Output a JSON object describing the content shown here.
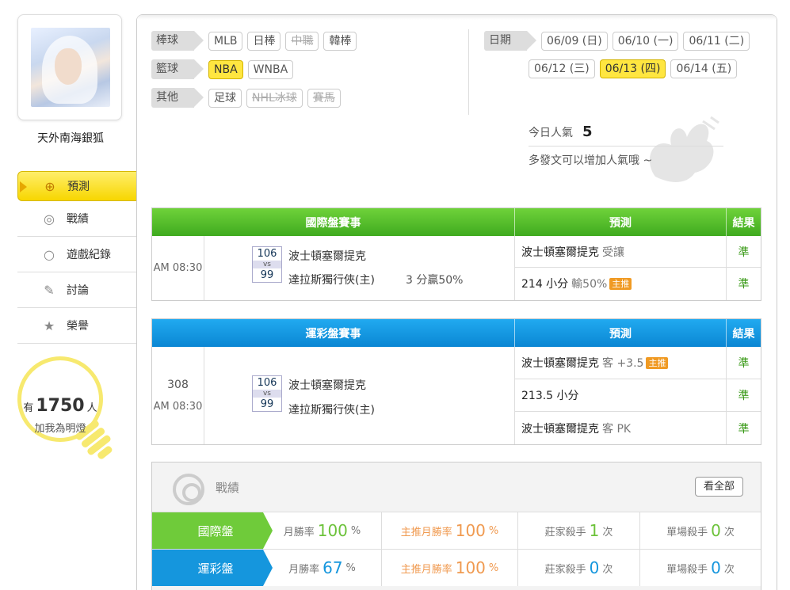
{
  "user": {
    "name": "天外南海銀狐"
  },
  "nav": [
    {
      "label": "預測",
      "icon": "target-icon",
      "active": true
    },
    {
      "label": "戰績",
      "icon": "chart-swirl-icon",
      "active": false
    },
    {
      "label": "遊戲紀錄",
      "icon": "ring-icon",
      "active": false
    },
    {
      "label": "討論",
      "icon": "discuss-icon",
      "active": false
    },
    {
      "label": "榮譽",
      "icon": "medal-icon",
      "active": false
    }
  ],
  "fans": {
    "prefix": "有",
    "count": "1750",
    "suffix": "人",
    "sub": "加我為明燈"
  },
  "filters": {
    "baseball": {
      "label": "棒球",
      "tags": [
        "MLB",
        "日棒",
        "中職",
        "韓棒"
      ]
    },
    "basketball": {
      "label": "籃球",
      "tags": [
        "NBA",
        "WNBA"
      ]
    },
    "other": {
      "label": "其他",
      "tags": [
        "足球",
        "NHL冰球",
        "賽馬"
      ]
    },
    "date": {
      "label": "日期",
      "tags": [
        "06/09 (日)",
        "06/10 (一)",
        "06/11 (二)",
        "06/12 (三)",
        "06/13 (四)",
        "06/14 (五)"
      ]
    }
  },
  "popularity": {
    "label": "今日人氣",
    "value": "5",
    "hint": "多發文可以增加人氣哦 ~"
  },
  "intl": {
    "header": {
      "game": "國際盤賽事",
      "pred": "預測",
      "result": "結果"
    },
    "time": "AM 08:30",
    "home_score": "106",
    "away_score": "99",
    "vs": "vs",
    "team1": "波士頓塞爾提克",
    "team2": "達拉斯獨行俠(主)",
    "extra": "3 分贏50%",
    "preds": [
      {
        "main": "波士頓塞爾提克",
        "sub": "受讓",
        "badge": "",
        "result": "準"
      },
      {
        "main": "214 小分",
        "sub": "輸50%",
        "badge": "主推",
        "result": "準"
      }
    ]
  },
  "sport": {
    "header": {
      "game": "運彩盤賽事",
      "pred": "預測",
      "result": "結果"
    },
    "num": "308",
    "time": "AM 08:30",
    "home_score": "106",
    "away_score": "99",
    "vs": "vs",
    "team1": "波士頓塞爾提克",
    "team2": "達拉斯獨行俠(主)",
    "preds": [
      {
        "main": "波士頓塞爾提克",
        "sub": "客 +3.5",
        "badge": "主推",
        "result": "準"
      },
      {
        "main": "213.5 小分",
        "sub": "",
        "badge": "",
        "result": "準"
      },
      {
        "main": "波士頓塞爾提克",
        "sub": "客 PK",
        "badge": "",
        "result": "準"
      }
    ]
  },
  "stats": {
    "title": "戰績",
    "see_all": "看全部",
    "rows": [
      {
        "label": "國際盤",
        "monthly_label": "月勝率",
        "monthly": "100",
        "pct": "%",
        "main_label": "主推月勝率",
        "main": "100",
        "dealer_label": "莊家殺手",
        "dealer": "1",
        "unit": "次",
        "single_label": "單場殺手",
        "single": "0"
      },
      {
        "label": "運彩盤",
        "monthly_label": "月勝率",
        "monthly": "67",
        "pct": "%",
        "main_label": "主推月勝率",
        "main": "100",
        "dealer_label": "莊家殺手",
        "dealer": "0",
        "unit": "次",
        "single_label": "單場殺手",
        "single": "0"
      }
    ]
  },
  "colors": {
    "green": "#6fcb3a",
    "blue": "#1596dd",
    "yellow": "#ffe640",
    "orange": "#f09a23"
  }
}
